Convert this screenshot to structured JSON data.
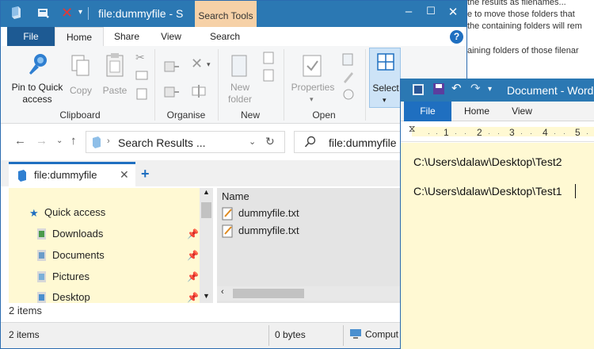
{
  "background_doc": {
    "lines": [
      "the results as filenames...",
      "e to move those folders that",
      "the containing folders will rem",
      "aining folders of those filenar"
    ]
  },
  "explorer": {
    "title": "file:dummyfile - S",
    "context_tab": "Search Tools",
    "tabs": [
      "File",
      "Home",
      "Share",
      "View",
      "Search"
    ],
    "help": "?",
    "ribbon": {
      "pin_label": "Pin to Quick access",
      "copy_label": "Copy",
      "paste_label": "Paste",
      "clipboard_group": "Clipboard",
      "organise_group": "Organise",
      "new_folder_label": "New folder",
      "new_group": "New",
      "properties_label": "Properties",
      "open_group": "Open",
      "select_label": "Select"
    },
    "address": {
      "path": "Search Results ...",
      "search_value": "file:dummyfile"
    },
    "folder_tab": {
      "label": "file:dummyfile",
      "close": "✕",
      "add": "+"
    },
    "nav": {
      "items": [
        {
          "label": "Quick access",
          "icon": "star-icon"
        },
        {
          "label": "Downloads",
          "icon": "downloads-icon"
        },
        {
          "label": "Documents",
          "icon": "documents-icon"
        },
        {
          "label": "Pictures",
          "icon": "pictures-icon"
        },
        {
          "label": "Desktop",
          "icon": "desktop-icon"
        }
      ]
    },
    "files": {
      "column_name": "Name",
      "rows": [
        "dummyfile.txt",
        "dummyfile.txt"
      ]
    },
    "items_count_row": "2 items",
    "status": {
      "items": "2 items",
      "size": "0 bytes",
      "location": "Comput"
    }
  },
  "word": {
    "title": "Document - Word",
    "tabs": [
      "File",
      "Home",
      "View"
    ],
    "ruler_numbers": [
      "1",
      "2",
      "3",
      "4",
      "5"
    ],
    "lines": [
      "C:\\Users\\dalaw\\Desktop\\Test2",
      "C:\\Users\\dalaw\\Desktop\\Test1"
    ]
  },
  "colors": {
    "titlebar": "#2b78b3",
    "file_tab": "#1d5a93",
    "search_tools": "#f6d1a7",
    "highlight_yellow": "#fff9d3",
    "accent": "#1f6fc0"
  }
}
